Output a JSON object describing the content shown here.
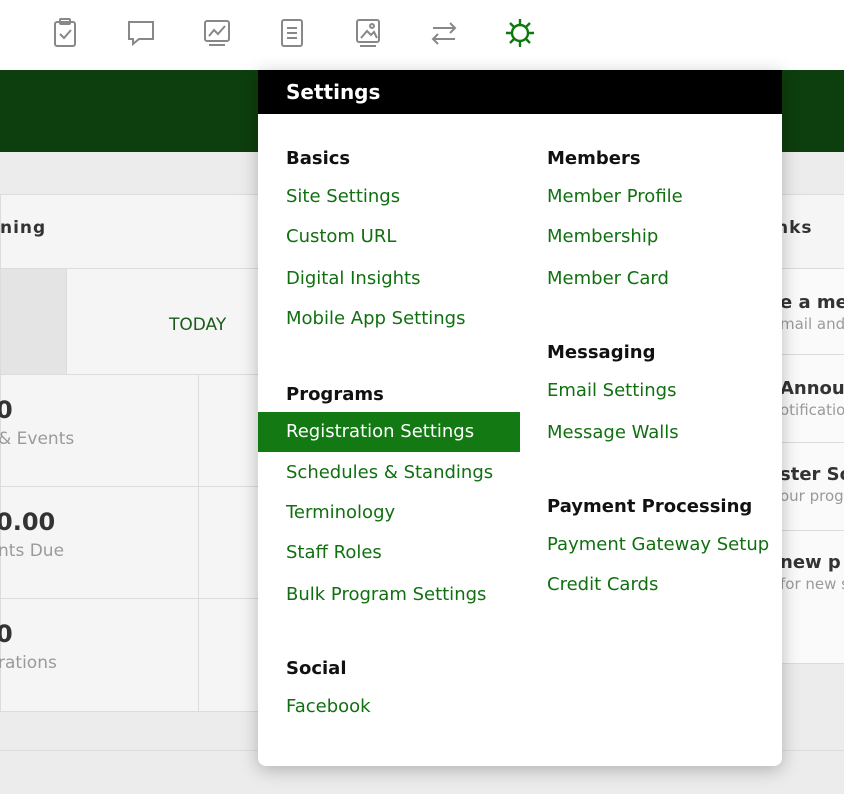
{
  "nav": {
    "icons": [
      {
        "name": "checklist-clipboard-icon"
      },
      {
        "name": "chat-bubble-icon"
      },
      {
        "name": "chart-line-icon"
      },
      {
        "name": "document-lines-icon"
      },
      {
        "name": "image-gallery-icon"
      },
      {
        "name": "transfer-arrows-icon"
      },
      {
        "name": "gear-icon",
        "active": true
      }
    ],
    "active_color": "#0d7a0d",
    "icon_color": "#888888"
  },
  "background": {
    "left_heading": "ning",
    "right_heading": "nks",
    "today_label": "TODAY",
    "stats": [
      {
        "value": "0",
        "label": "& Events"
      },
      {
        "value": "0.00",
        "label": "nts Due"
      },
      {
        "value": "0",
        "label": "rations"
      }
    ],
    "right_items": [
      {
        "title": "e a mes",
        "sub": "mail and/"
      },
      {
        "title": "Annou",
        "sub": "otification"
      },
      {
        "title": "ster Sc",
        "sub": "our prog"
      },
      {
        "title": " new p",
        "sub": "for new s"
      }
    ]
  },
  "settings": {
    "title": "Settings",
    "basics": {
      "title": "Basics",
      "links": [
        "Site Settings",
        "Custom URL",
        "Digital Insights",
        "Mobile App Settings"
      ]
    },
    "programs": {
      "title": "Programs",
      "links": [
        "Registration Settings",
        "Schedules & Standings",
        "Terminology",
        "Staff Roles",
        "Bulk Program Settings"
      ],
      "highlighted_index": 0
    },
    "social": {
      "title": "Social",
      "links": [
        "Facebook"
      ]
    },
    "members": {
      "title": "Members",
      "links": [
        "Member Profile",
        "Membership",
        "Member Card"
      ]
    },
    "messaging": {
      "title": "Messaging",
      "links": [
        "Email Settings",
        "Message Walls"
      ]
    },
    "payment": {
      "title": "Payment Processing",
      "links": [
        "Payment Gateway Setup",
        "Credit Cards"
      ]
    }
  },
  "colors": {
    "banner": "#0d3e0d",
    "link": "#107010",
    "highlight_bg": "#137a13"
  }
}
